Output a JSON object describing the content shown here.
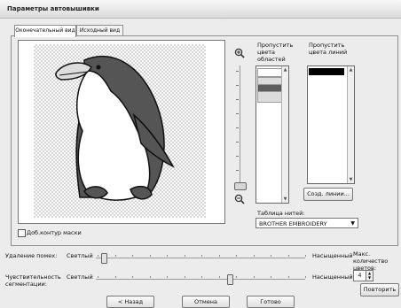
{
  "window": {
    "title": "Параметры автовышивки"
  },
  "tabs": [
    {
      "label": "Оконечательный вид",
      "active": true
    },
    {
      "label": "Исходный вид",
      "active": false
    }
  ],
  "preview": {
    "mask_outline_label": "Доб.контур маски",
    "mask_outline_checked": false
  },
  "zoom": {
    "zoom_in_icon": "zoom-in-magnifier",
    "zoom_out_icon": "zoom-out-magnifier"
  },
  "skip_region_colors": {
    "label": "Пропустить цвета областей",
    "items": [
      {
        "color": "#ffffff"
      },
      {
        "color": "#dcdcdc"
      },
      {
        "color": "#5d5d5d"
      },
      {
        "color": "#dcdcdc"
      }
    ]
  },
  "skip_line_colors": {
    "label": "Пропустить цвета линий",
    "items": [
      {
        "color": "#000000"
      }
    ]
  },
  "create_lines_button": "Созд. линии...",
  "thread_table": {
    "label": "Таблица нитей:",
    "value": "BROTHER EMBROIDERY"
  },
  "noise_removal": {
    "label": "Удаление помех:",
    "min_label": "Светлый",
    "max_label": "Насыщенный",
    "level": 0.04
  },
  "segmentation_sensitivity": {
    "label": "Чувствительность сегментации:",
    "min_label": "Светлый",
    "max_label": "Насыщенный",
    "level": 0.64
  },
  "max_colors": {
    "label": "Макс. количество цветов:",
    "value": "4"
  },
  "buttons": {
    "retry": "Повторить",
    "back": "< Назад",
    "cancel": "Отмена",
    "done": "Готово"
  },
  "colors": {
    "penguin_dark": "#555555",
    "penguin_light": "#dddddd",
    "penguin_white": "#ffffff"
  }
}
